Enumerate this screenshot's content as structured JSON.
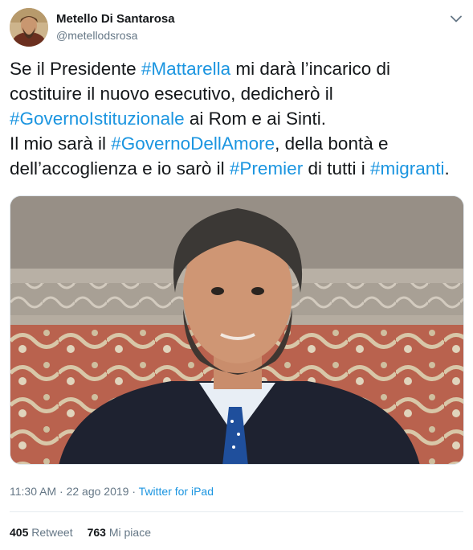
{
  "user": {
    "display_name": "Metello Di Santarosa",
    "handle": "@metellodsrosa"
  },
  "tweet": {
    "lines": [
      [
        {
          "text": "Se il Presidente ",
          "hashtag": false
        },
        {
          "text": "#Mattarella",
          "hashtag": true
        },
        {
          "text": " mi darà l’incarico di",
          "hashtag": false
        }
      ],
      [
        {
          "text": "costituire il nuovo esecutivo, dedicherò il",
          "hashtag": false
        }
      ],
      [
        {
          "text": "#GovernoIstituzionale",
          "hashtag": true
        },
        {
          "text": " ai Rom e ai Sinti.",
          "hashtag": false
        }
      ],
      [
        {
          "text": "Il mio sarà il ",
          "hashtag": false
        },
        {
          "text": "#GovernoDellAmore",
          "hashtag": true
        },
        {
          "text": ", della bontà e",
          "hashtag": false
        }
      ],
      [
        {
          "text": "dell’accoglienza e io sarò il ",
          "hashtag": false
        },
        {
          "text": "#Premier",
          "hashtag": true
        },
        {
          "text": " di tutti i ",
          "hashtag": false
        },
        {
          "text": "#migranti",
          "hashtag": true
        },
        {
          "text": ".",
          "hashtag": false
        }
      ]
    ]
  },
  "meta": {
    "time": "11:30 AM",
    "separator": " · ",
    "date": "22 ago 2019",
    "source": "Twitter for iPad"
  },
  "stats": {
    "retweets": "405",
    "retweets_label": "Retweet",
    "likes": "763",
    "likes_label": "Mi piace"
  },
  "colors": {
    "link": "#1b95e0",
    "muted": "#657786",
    "text": "#14171a"
  },
  "icons": {
    "caret": "chevron-down-icon"
  }
}
